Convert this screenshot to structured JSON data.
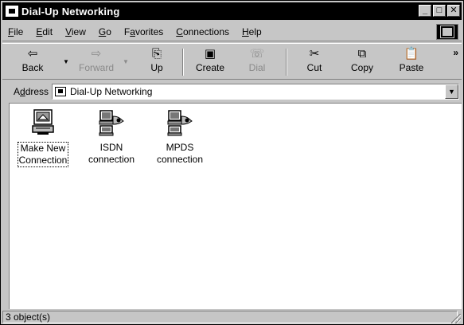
{
  "window": {
    "title": "Dial-Up Networking",
    "controls": {
      "minimize": "_",
      "maximize": "□",
      "close": "✕"
    }
  },
  "menu": [
    {
      "u": "F",
      "rest": "ile"
    },
    {
      "u": "E",
      "rest": "dit"
    },
    {
      "u": "V",
      "rest": "iew"
    },
    {
      "u": "G",
      "rest": "o"
    },
    {
      "pre": "F",
      "u": "a",
      "rest": "vorites"
    },
    {
      "u": "C",
      "rest": "onnections"
    },
    {
      "u": "H",
      "rest": "elp"
    }
  ],
  "toolbar": {
    "back": "Back",
    "forward": "Forward",
    "up": "Up",
    "create": "Create",
    "dial": "Dial",
    "cut": "Cut",
    "copy": "Copy",
    "paste": "Paste",
    "more": "»"
  },
  "address": {
    "label_u": "d",
    "label_pre": "A",
    "label_rest": "dress",
    "value": "Dial-Up Networking"
  },
  "items": [
    {
      "line1": "Make New",
      "line2": "Connection",
      "icon": "make-new-connection-icon"
    },
    {
      "line1": "ISDN",
      "line2": "connection",
      "icon": "dialup-connection-icon"
    },
    {
      "line1": "MPDS",
      "line2": "connection",
      "icon": "dialup-connection-icon"
    }
  ],
  "status": {
    "text": "3 object(s)"
  }
}
